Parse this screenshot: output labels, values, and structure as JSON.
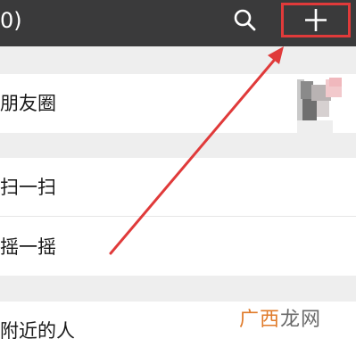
{
  "header": {
    "title_fragment": "0)",
    "search_icon": "search-icon",
    "add_icon": "plus-icon"
  },
  "rows": {
    "moments": {
      "label": "朋友圈"
    },
    "scan": {
      "label": "扫一扫"
    },
    "shake": {
      "label": "摇一摇"
    },
    "nearby": {
      "label": "附近的人"
    }
  },
  "annotation": {
    "highlight_color": "#e03a3a",
    "arrow_color": "#e03a3a"
  },
  "watermark": {
    "part1": "广西",
    "part2": "龙网"
  },
  "colors": {
    "topbar": "#3a3a3b",
    "background": "#ededed",
    "row": "#ffffff"
  }
}
